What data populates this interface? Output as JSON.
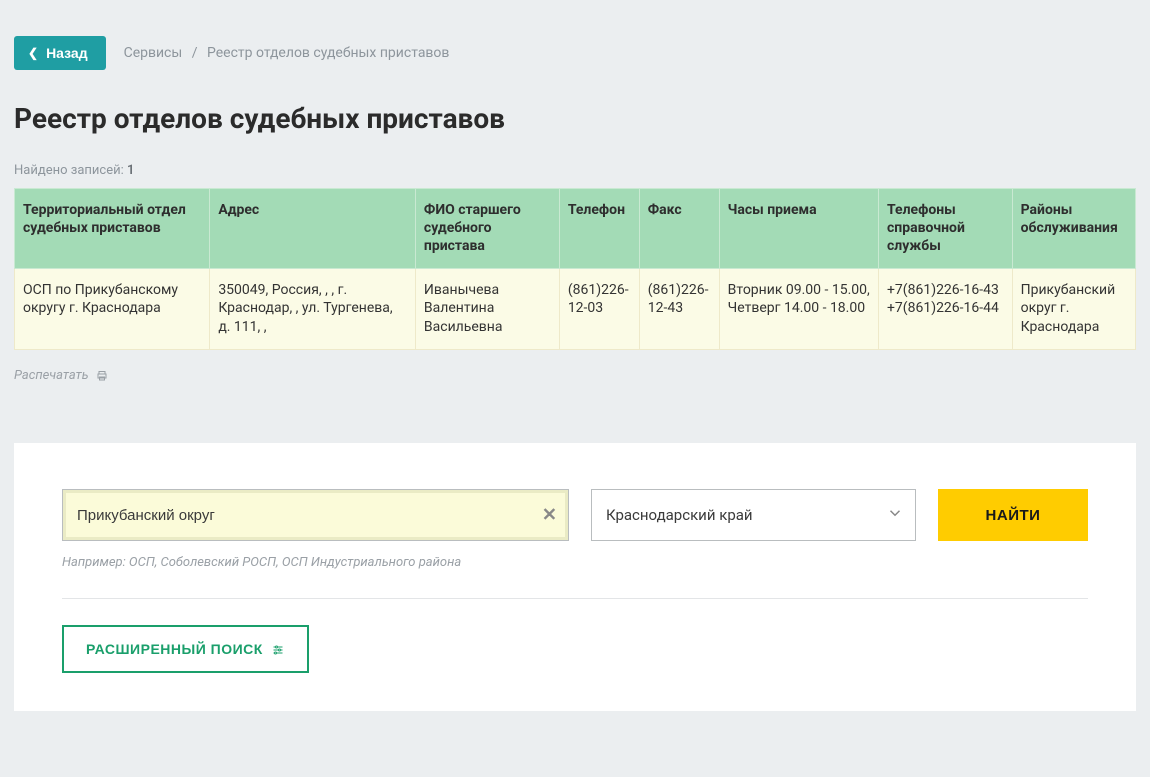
{
  "topbar": {
    "back_label": "Назад",
    "breadcrumb_services": "Сервисы",
    "breadcrumb_current": "Реестр отделов судебных приставов"
  },
  "page": {
    "title": "Реестр отделов судебных приставов",
    "found_prefix": "Найдено записей: ",
    "found_count": "1",
    "print_label": "Распечатать"
  },
  "table": {
    "headers": {
      "dept": "Территориальный отдел судебных приставов",
      "address": "Адрес",
      "fio": "ФИО старшего судебного пристава",
      "phone": "Телефон",
      "fax": "Факс",
      "hours": "Часы приема",
      "helpdesk": "Телефоны справочной службы",
      "districts": "Районы обслуживания"
    },
    "rows": [
      {
        "dept": "ОСП по Прикубанскому округу г. Краснодара",
        "address": "350049, Россия, , , г. Краснодар, , ул. Тургенева, д. 111, ,",
        "fio": "Иванычева Валентина Васильевна",
        "phone": "(861)226-12-03",
        "fax": "(861)226-12-43",
        "hours": "Вторник 09.00 - 15.00, Четверг 14.00 - 18.00",
        "helpdesk": "+7(861)226-16-43 +7(861)226-16-44",
        "districts": "Прикубанский округ г. Краснодара"
      }
    ]
  },
  "search": {
    "query_value": "Прикубанский округ",
    "region_value": "Краснодарский край",
    "find_label": "НАЙТИ",
    "hint": "Например: ОСП, Соболевский РОСП, ОСП Индустриального района",
    "advanced_label": "РАСШИРЕННЫЙ ПОИСК"
  }
}
